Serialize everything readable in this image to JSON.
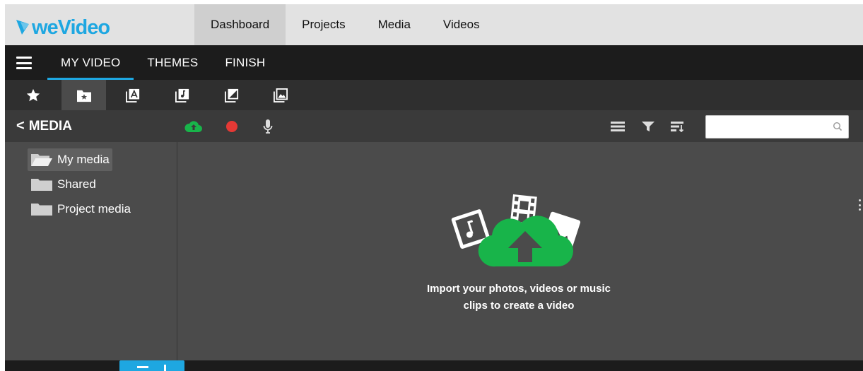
{
  "app": {
    "logo_text": "weVideo",
    "brand_color": "#1ea7e1",
    "accent_green": "#18b44a",
    "record_red": "#e53935"
  },
  "topnav": {
    "tabs": [
      {
        "label": "Dashboard",
        "active": true
      },
      {
        "label": "Projects",
        "active": false
      },
      {
        "label": "Media",
        "active": false
      },
      {
        "label": "Videos",
        "active": false
      }
    ]
  },
  "editor": {
    "menu_icon": "hamburger-icon",
    "tabs": [
      {
        "label": "MY VIDEO",
        "active": true
      },
      {
        "label": "THEMES",
        "active": false
      },
      {
        "label": "FINISH",
        "active": false
      }
    ]
  },
  "library": {
    "icons": [
      {
        "name": "star-icon",
        "active": false
      },
      {
        "name": "folder-star-icon",
        "active": true
      },
      {
        "name": "text-layers-icon",
        "active": false
      },
      {
        "name": "music-layers-icon",
        "active": false
      },
      {
        "name": "transition-layers-icon",
        "active": false
      },
      {
        "name": "image-layers-icon",
        "active": false
      }
    ]
  },
  "media": {
    "back_label": "MEDIA",
    "actions": [
      "upload-cloud-icon",
      "record-icon",
      "microphone-icon"
    ],
    "view_controls": [
      "list-view-icon",
      "filter-icon",
      "sort-icon"
    ],
    "search": {
      "value": "",
      "placeholder": ""
    }
  },
  "folders": [
    {
      "label": "My media",
      "selected": true,
      "icon": "folder-open-icon"
    },
    {
      "label": "Shared",
      "selected": false,
      "icon": "folder-icon"
    },
    {
      "label": "Project media",
      "selected": false,
      "icon": "folder-icon"
    }
  ],
  "dropzone": {
    "line1": "Import your photos, videos or music",
    "line2": "clips to create a video"
  }
}
